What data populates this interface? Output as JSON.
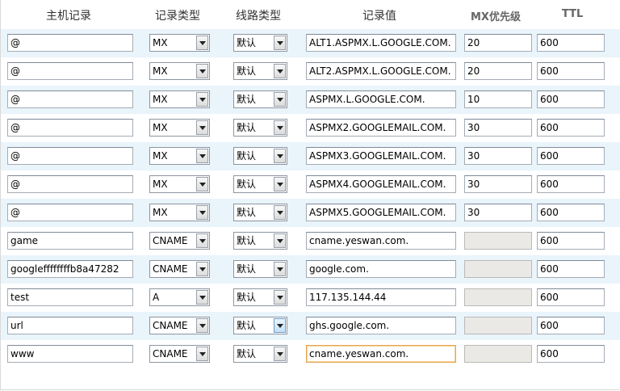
{
  "headers": {
    "host": "主机记录",
    "type": "记录类型",
    "line": "线路类型",
    "value": "记录值",
    "mx": "MX优先级",
    "ttl": "TTL"
  },
  "rows": [
    {
      "host": "@",
      "type": "MX",
      "line": "默认",
      "value": "ALT1.ASPMX.L.GOOGLE.COM.",
      "mx": "20",
      "ttl": "600"
    },
    {
      "host": "@",
      "type": "MX",
      "line": "默认",
      "value": "ALT2.ASPMX.L.GOOGLE.COM.",
      "mx": "20",
      "ttl": "600"
    },
    {
      "host": "@",
      "type": "MX",
      "line": "默认",
      "value": "ASPMX.L.GOOGLE.COM.",
      "mx": "10",
      "ttl": "600"
    },
    {
      "host": "@",
      "type": "MX",
      "line": "默认",
      "value": "ASPMX2.GOOGLEMAIL.COM.",
      "mx": "30",
      "ttl": "600"
    },
    {
      "host": "@",
      "type": "MX",
      "line": "默认",
      "value": "ASPMX3.GOOGLEMAIL.COM.",
      "mx": "30",
      "ttl": "600"
    },
    {
      "host": "@",
      "type": "MX",
      "line": "默认",
      "value": "ASPMX4.GOOGLEMAIL.COM.",
      "mx": "30",
      "ttl": "600"
    },
    {
      "host": "@",
      "type": "MX",
      "line": "默认",
      "value": "ASPMX5.GOOGLEMAIL.COM.",
      "mx": "30",
      "ttl": "600"
    },
    {
      "host": "game",
      "type": "CNAME",
      "line": "默认",
      "value": "cname.yeswan.com.",
      "mx": "",
      "ttl": "600"
    },
    {
      "host": "googleffffffffb8a47282",
      "type": "CNAME",
      "line": "默认",
      "value": "google.com.",
      "mx": "",
      "ttl": "600"
    },
    {
      "host": "test",
      "type": "A",
      "line": "默认",
      "value": "117.135.144.44",
      "mx": "",
      "ttl": "600"
    },
    {
      "host": "url",
      "type": "CNAME",
      "line": "默认",
      "value": "ghs.google.com.",
      "mx": "",
      "ttl": "600"
    },
    {
      "host": "www",
      "type": "CNAME",
      "line": "默认",
      "value": "cname.yeswan.com.",
      "mx": "",
      "ttl": "600"
    }
  ],
  "colors": {
    "alt_row": "#e9f4fb",
    "focus_border": "#e6a652",
    "disabled_bg": "#ebe9e5"
  }
}
